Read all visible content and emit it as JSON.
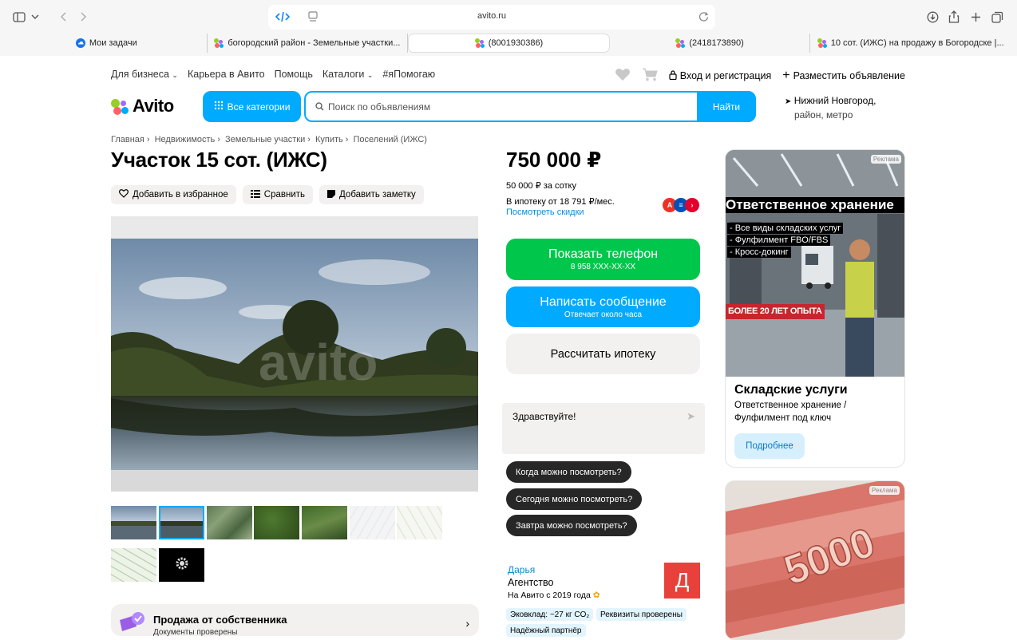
{
  "browser": {
    "url": "avito.ru",
    "tabs": [
      {
        "label": "Мои задачи",
        "favicon": "cloud-icon"
      },
      {
        "label": "богородский район - Земельные участки...",
        "favicon": "avito-icon"
      },
      {
        "label": "(8001930386)",
        "favicon": "avito-icon",
        "active": true
      },
      {
        "label": "(2418173890)",
        "favicon": "avito-icon"
      },
      {
        "label": "10 сот. (ИЖС) на продажу в Богородске |...",
        "favicon": "avito-icon"
      }
    ]
  },
  "header": {
    "links": [
      "Для бизнеса",
      "Карьера в Авито",
      "Помощь",
      "Каталоги",
      "#яПомогаю"
    ],
    "login": "Вход и регистрация",
    "post_ad": "Разместить объявление",
    "logo": "Avito",
    "categories": "Все категории",
    "search_placeholder": "Поиск по объявлениям",
    "search_button": "Найти",
    "location_line1": "Нижний Новгород,",
    "location_line2": "район, метро"
  },
  "breadcrumbs": [
    "Главная",
    "Недвижимость",
    "Земельные участки",
    "Купить",
    "Поселений (ИЖС)"
  ],
  "listing": {
    "title": "Участок 15 сот. (ИЖС)",
    "actions": [
      "Добавить в избранное",
      "Сравнить",
      "Добавить заметку"
    ],
    "price": "750 000 ₽",
    "price_per_are": "50 000 ₽ за сотку",
    "mortgage": "В ипотеку от 18 791 ₽/мес.",
    "discounts": "Посмотреть скидки",
    "photo_watermark": "avito",
    "thumb_count": 9,
    "selected_thumb": 1
  },
  "contact": {
    "phone_label": "Показать телефон",
    "phone_masked": "8 958 XXX-XX-XX",
    "message_label": "Написать сообщение",
    "message_sub": "Отвечает около часа",
    "calc_label": "Рассчитать ипотеку",
    "chat_greeting": "Здравствуйте!",
    "quick_replies": [
      "Когда можно посмотреть?",
      "Сегодня можно посмотреть?",
      "Завтра можно посмотреть?"
    ]
  },
  "seller": {
    "name": "Дарья",
    "type": "Агентство",
    "since": "На Авито с 2019 года",
    "avatar_letter": "Д",
    "badges": [
      "Эковклад: ~27 кг CO₂",
      "Реквизиты проверены",
      "Надёжный партнёр"
    ]
  },
  "owner_block": {
    "title": "Продажа от собственника",
    "subtitle": "Документы проверены"
  },
  "ads": [
    {
      "label": "Реклама",
      "headline": "Ответственное хранение",
      "bullets": [
        "- Все виды складских услуг",
        "- Фулфилмент FBO/FBS",
        "- Кросс-докинг"
      ],
      "experience": "БОЛЕЕ 20 ЛЕТ ОПЫТА",
      "title": "Складские услуги",
      "text": "Ответственное хранение / Фулфилмент под ключ",
      "button": "Подробнее"
    },
    {
      "label": "Реклама",
      "banknote": "5000"
    }
  ],
  "colors": {
    "accent": "#00aaff",
    "green": "#00c74b",
    "avatar": "#e8413b"
  }
}
